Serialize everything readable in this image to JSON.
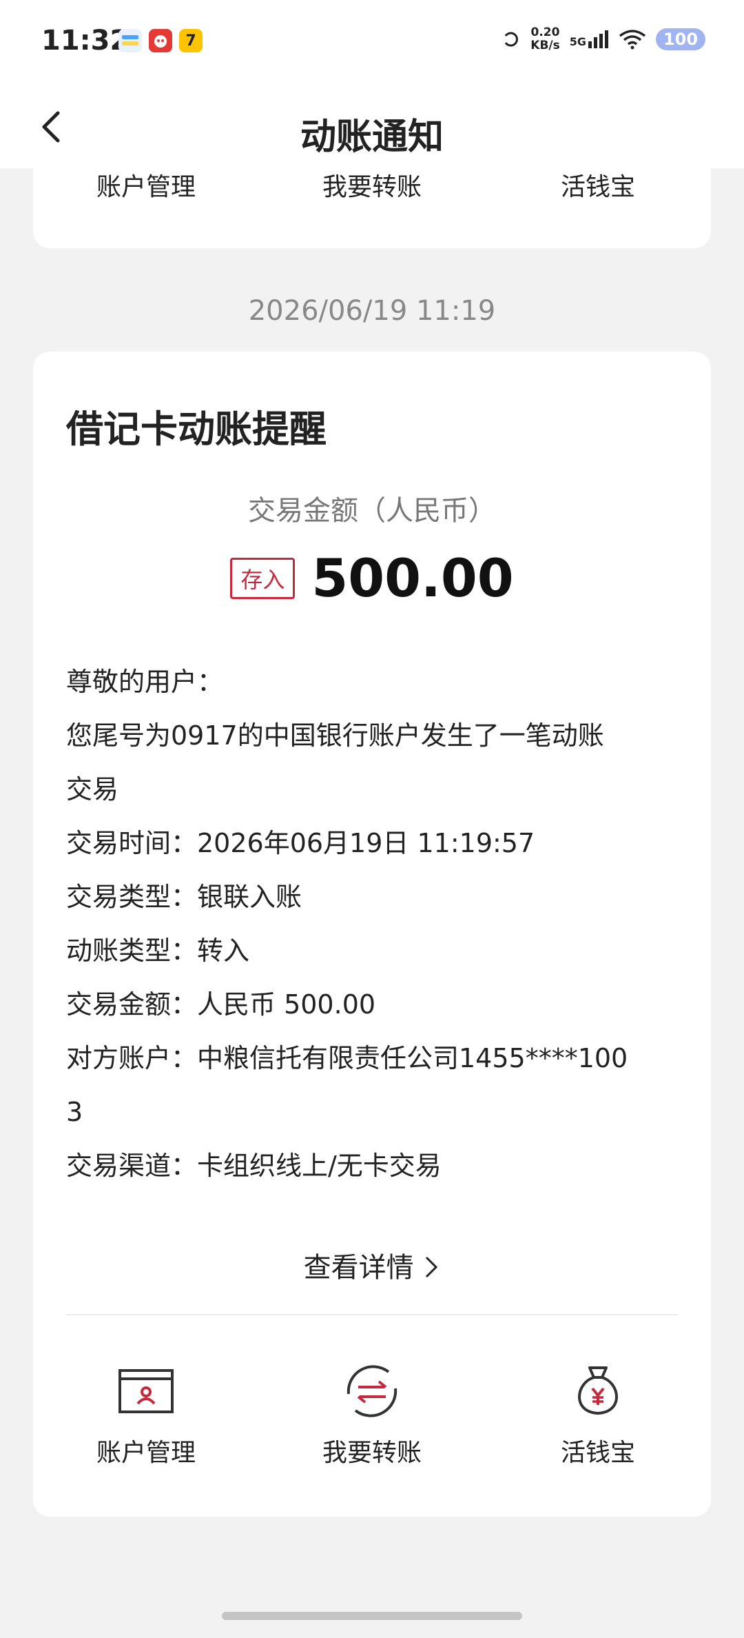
{
  "status_bar": {
    "time": "11:32",
    "apps": [
      "blue-app",
      "red-app",
      "7"
    ],
    "net_speed_value": "0.20",
    "net_speed_unit": "KB/s",
    "network": "5G",
    "battery": "100"
  },
  "header": {
    "title": "动账通知"
  },
  "top_card": {
    "items": [
      "账户管理",
      "我要转账",
      "活钱宝"
    ]
  },
  "timestamp": "2026/06/19 11:19",
  "notice": {
    "title": "借记卡动账提醒",
    "amount_label": "交易金额（人民币）",
    "badge": "存入",
    "amount": "500.00",
    "lines": [
      "尊敬的用户：",
      "您尾号为0917的中国银行账户发生了一笔动账",
      "交易",
      "交易时间：2026年06月19日 11:19:57",
      "交易类型：银联入账",
      "动账类型：转入",
      "交易金额：人民币 500.00",
      "对方账户：中粮信托有限责任公司1455****100",
      "3",
      "交易渠道：卡组织线上/无卡交易"
    ],
    "detail_link": "查看详情"
  },
  "bottom_actions": [
    {
      "label": "账户管理",
      "icon": "account-card-icon"
    },
    {
      "label": "我要转账",
      "icon": "transfer-icon"
    },
    {
      "label": "活钱宝",
      "icon": "money-bag-icon"
    }
  ],
  "colors": {
    "accent": "#c8283c",
    "background": "#f2f2f2",
    "card": "#ffffff"
  }
}
